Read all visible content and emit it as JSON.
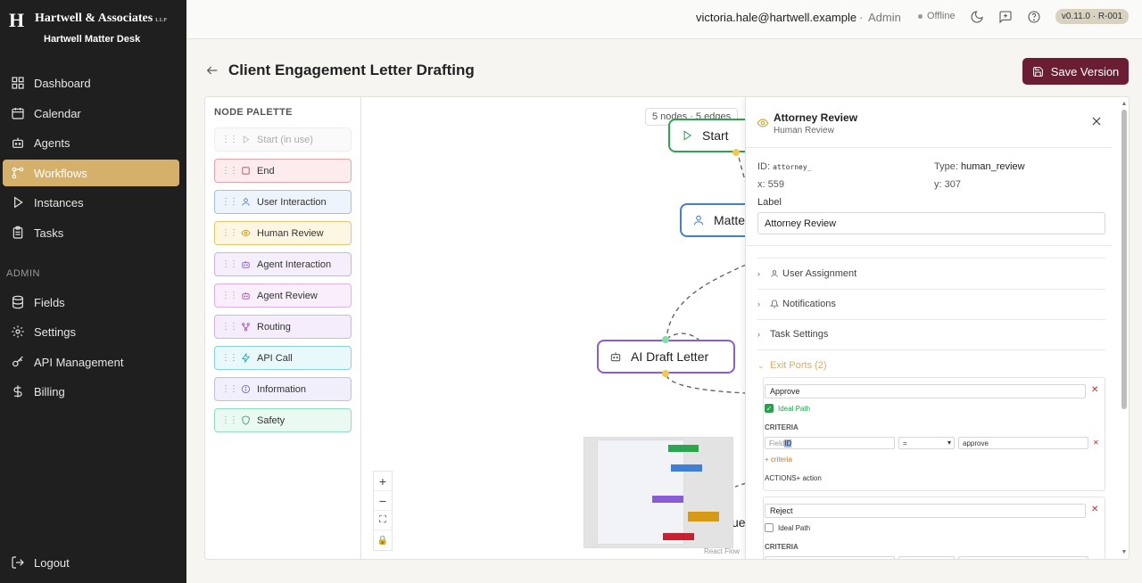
{
  "brand": {
    "logo_letter": "H",
    "firm_name": "Hartwell & Associates",
    "firm_suffix": "LLP",
    "desk_name": "Hartwell Matter Desk"
  },
  "sidebar": {
    "items": [
      {
        "label": "Dashboard",
        "icon": "dashboard-icon"
      },
      {
        "label": "Calendar",
        "icon": "calendar-icon"
      },
      {
        "label": "Agents",
        "icon": "robot-icon"
      },
      {
        "label": "Workflows",
        "icon": "workflow-icon",
        "active": true
      },
      {
        "label": "Instances",
        "icon": "play-icon"
      },
      {
        "label": "Tasks",
        "icon": "clipboard-icon"
      }
    ],
    "admin_label": "ADMIN",
    "admin_items": [
      {
        "label": "Fields",
        "icon": "database-icon"
      },
      {
        "label": "Settings",
        "icon": "gear-icon"
      },
      {
        "label": "API Management",
        "icon": "key-icon"
      },
      {
        "label": "Billing",
        "icon": "dollar-icon"
      }
    ],
    "logout_label": "Logout"
  },
  "topbar": {
    "email": "victoria.hale@hartwell.example",
    "separator": "·",
    "role": "Admin",
    "status": "Offline",
    "version": "v0.11.0 · R-001"
  },
  "page": {
    "title": "Client Engagement Letter Drafting",
    "save_label": "Save Version"
  },
  "palette": {
    "heading": "NODE PALETTE",
    "items": [
      {
        "label": "Start (in use)",
        "icon": "play-icon",
        "disabled": true
      },
      {
        "label": "End",
        "icon": "square-icon"
      },
      {
        "label": "User Interaction",
        "icon": "user-icon"
      },
      {
        "label": "Human Review",
        "icon": "eye-icon"
      },
      {
        "label": "Agent Interaction",
        "icon": "robot-icon"
      },
      {
        "label": "Agent Review",
        "icon": "robot-icon"
      },
      {
        "label": "Routing",
        "icon": "routing-icon"
      },
      {
        "label": "API Call",
        "icon": "bolt-icon"
      },
      {
        "label": "Information",
        "icon": "info-icon"
      },
      {
        "label": "Safety",
        "icon": "shield-icon"
      }
    ]
  },
  "canvas": {
    "counts": "5 nodes · 5 edges",
    "nodes": [
      {
        "label": "Start"
      },
      {
        "label": "Matte"
      },
      {
        "label": "AI Draft Letter"
      },
      {
        "label": "ue"
      }
    ],
    "zoom_in": "+",
    "zoom_out": "−",
    "attribution": "React Flow"
  },
  "panel": {
    "title": "Attorney Review",
    "subtitle": "Human Review",
    "id_label": "ID:",
    "id_value": "attorney_",
    "type_label": "Type:",
    "type_value": "human_review",
    "x_text": "x: 559",
    "y_text": "y: 307",
    "label_caption": "Label",
    "label_value": "Attorney Review",
    "sections": [
      {
        "label": "User Assignment",
        "icon": "user-icon"
      },
      {
        "label": "Notifications",
        "icon": "bell-icon"
      },
      {
        "label": "Task Settings",
        "icon": ""
      }
    ],
    "exit_ports_label": "Exit Ports (2)",
    "ports": [
      {
        "name": "Approve",
        "ideal_label": "Ideal Path",
        "ideal": true,
        "criteria_label": "CRITERIA",
        "field_placeholder": "Field ",
        "field_selected": "ID",
        "operator": "=",
        "value": "approve",
        "add_criteria": "+ criteria",
        "actions": "ACTIONS+ action"
      },
      {
        "name": "Reject",
        "ideal_label": "Ideal Path",
        "ideal": false,
        "criteria_label": "CRITERIA"
      }
    ]
  },
  "colors": {
    "accent": "#d4b06a",
    "brand_dark": "#6b1d33",
    "sidebar_bg": "#1f1f1f"
  }
}
